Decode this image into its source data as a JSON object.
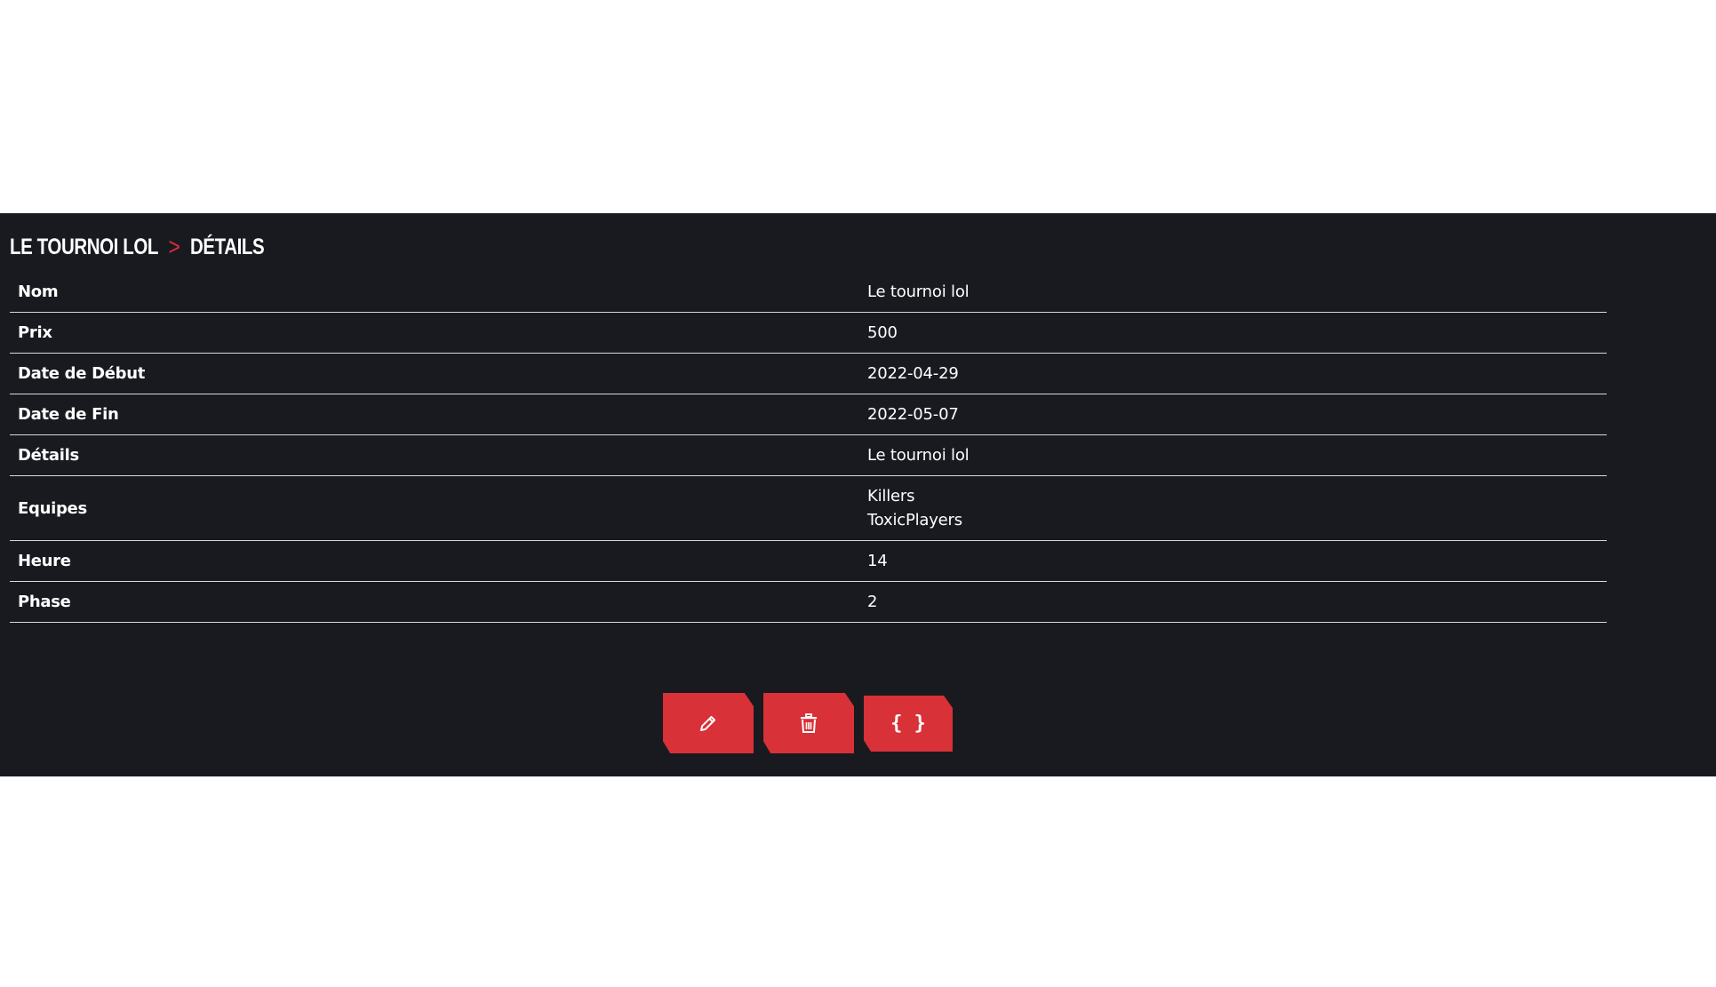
{
  "breadcrumb": {
    "parent": "LE TOURNOI LOL",
    "separator": ">",
    "current": "DÉTAILS"
  },
  "details": [
    {
      "label": "Nom",
      "values": [
        "Le tournoi lol"
      ]
    },
    {
      "label": "Prix",
      "values": [
        "500"
      ]
    },
    {
      "label": "Date de Début",
      "values": [
        "2022-04-29"
      ]
    },
    {
      "label": "Date de Fin",
      "values": [
        "2022-05-07"
      ]
    },
    {
      "label": "Détails",
      "values": [
        "Le tournoi lol"
      ]
    },
    {
      "label": "Equipes",
      "values": [
        "Killers",
        "ToxicPlayers"
      ]
    },
    {
      "label": "Heure",
      "values": [
        "14"
      ]
    },
    {
      "label": "Phase",
      "values": [
        "2"
      ]
    }
  ],
  "actions": {
    "edit_icon": "pencil-icon",
    "delete_icon": "trash-icon",
    "json_label": "{ }"
  },
  "colors": {
    "panel_background": "#181a20",
    "accent": "#d83137",
    "text": "#ffffff",
    "divider": "#d9d9d9",
    "page_background": "#ffffff"
  }
}
